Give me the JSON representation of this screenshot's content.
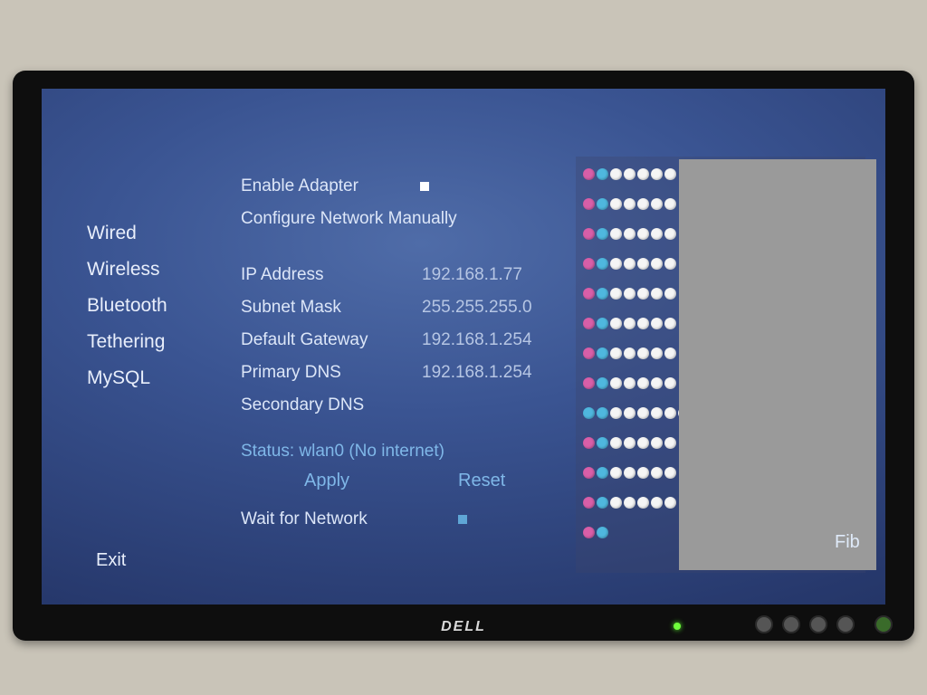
{
  "sidebar": {
    "items": [
      {
        "label": "Wired"
      },
      {
        "label": "Wireless"
      },
      {
        "label": "Bluetooth"
      },
      {
        "label": "Tethering"
      },
      {
        "label": "MySQL"
      }
    ],
    "exit": "Exit"
  },
  "settings": {
    "enable_adapter_label": "Enable Adapter",
    "configure_manual_label": "Configure Network Manually",
    "ip_label": "IP Address",
    "ip_value": "192.168.1.77",
    "subnet_label": "Subnet Mask",
    "subnet_value": "255.255.255.0",
    "gateway_label": "Default Gateway",
    "gateway_value": "192.168.1.254",
    "pdns_label": "Primary DNS",
    "pdns_value": "192.168.1.254",
    "sdns_label": "Secondary DNS",
    "sdns_value": "",
    "status_label": "Status: wlan0 (No internet)",
    "apply": "Apply",
    "reset": "Reset",
    "wait_label": "Wait for Network"
  },
  "right": {
    "fib": "Fib"
  }
}
